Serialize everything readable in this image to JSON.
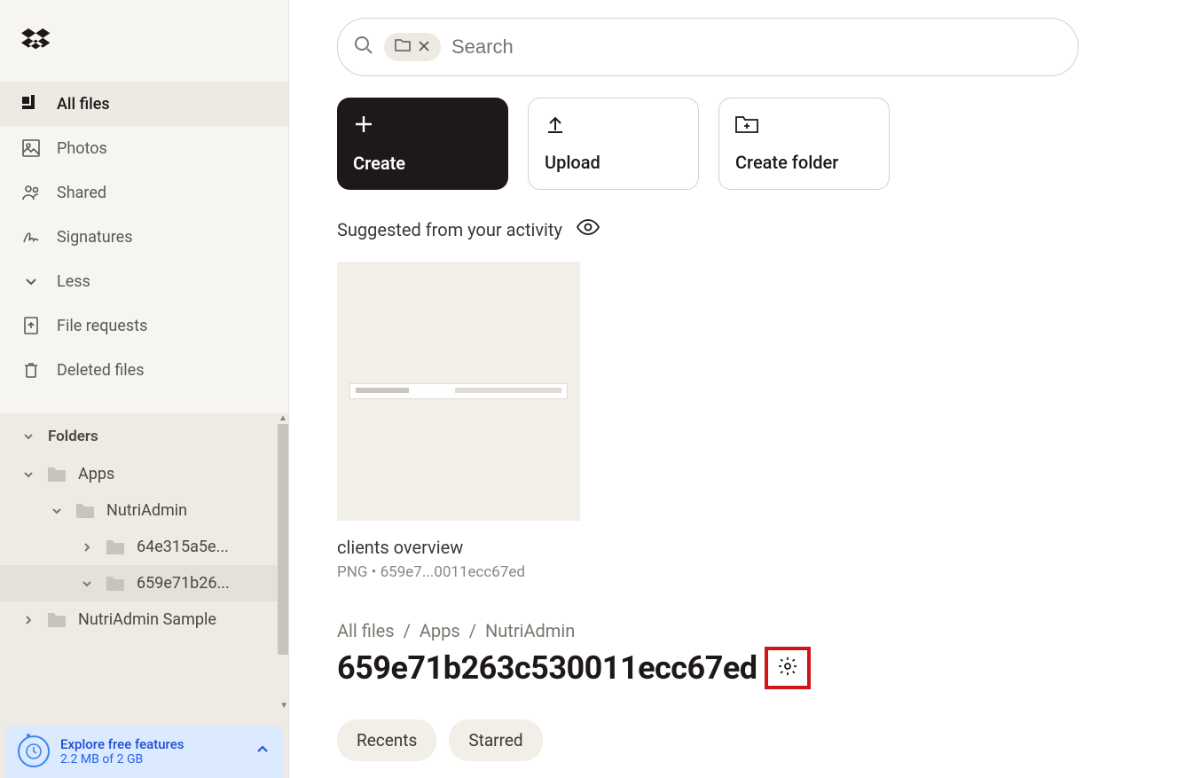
{
  "sidebar": {
    "nav": [
      {
        "label": "All files",
        "icon": "grid-icon",
        "active": true
      },
      {
        "label": "Photos",
        "icon": "photo-icon",
        "active": false
      },
      {
        "label": "Shared",
        "icon": "shared-icon",
        "active": false
      },
      {
        "label": "Signatures",
        "icon": "signature-icon",
        "active": false
      },
      {
        "label": "Less",
        "icon": "chevron-down-icon",
        "active": false
      },
      {
        "label": "File requests",
        "icon": "file-request-icon",
        "active": false
      },
      {
        "label": "Deleted files",
        "icon": "trash-icon",
        "active": false
      }
    ],
    "folders_header": "Folders",
    "tree": [
      {
        "label": "Apps",
        "depth": 1,
        "expanded": true,
        "chev": "down"
      },
      {
        "label": "NutriAdmin",
        "depth": 2,
        "expanded": true,
        "chev": "down"
      },
      {
        "label": "64e315a5e...",
        "depth": 3,
        "expanded": false,
        "chev": "right"
      },
      {
        "label": "659e71b26...",
        "depth": 3,
        "expanded": true,
        "chev": "down",
        "selected": true
      },
      {
        "label": "NutriAdmin Sample",
        "depth": 1,
        "expanded": false,
        "chev": "right"
      }
    ],
    "promo": {
      "title": "Explore free features",
      "sub": "2.2 MB of 2 GB"
    }
  },
  "search": {
    "placeholder": "Search"
  },
  "actions": {
    "create": "Create",
    "upload": "Upload",
    "create_folder": "Create folder"
  },
  "suggested_label": "Suggested from your activity",
  "suggested": {
    "title": "clients overview",
    "meta": "PNG • 659e7...0011ecc67ed"
  },
  "breadcrumb": [
    "All files",
    "Apps",
    "NutriAdmin"
  ],
  "folder_title": "659e71b263c530011ecc67ed",
  "pills": [
    "Recents",
    "Starred"
  ]
}
